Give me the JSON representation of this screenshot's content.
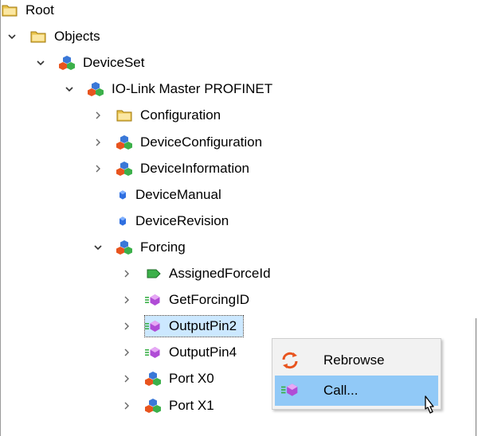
{
  "tree": {
    "items": [
      {
        "label": "Root",
        "icon": "folder-icon",
        "expanded": true
      },
      {
        "label": "Objects",
        "icon": "folder-icon",
        "expanded": true
      },
      {
        "label": "DeviceSet",
        "icon": "object-icon",
        "expanded": true
      },
      {
        "label": "IO-Link Master PROFINET",
        "icon": "object-icon",
        "expanded": true
      },
      {
        "label": "Configuration",
        "icon": "folder-icon",
        "expanded": false
      },
      {
        "label": "DeviceConfiguration",
        "icon": "object-icon",
        "expanded": false
      },
      {
        "label": "DeviceInformation",
        "icon": "object-icon",
        "expanded": false
      },
      {
        "label": "DeviceManual",
        "icon": "property-icon"
      },
      {
        "label": "DeviceRevision",
        "icon": "property-icon"
      },
      {
        "label": "Forcing",
        "icon": "object-icon",
        "expanded": true
      },
      {
        "label": "AssignedForceId",
        "icon": "variable-icon",
        "expanded": false
      },
      {
        "label": "GetForcingID",
        "icon": "method-icon",
        "expanded": false
      },
      {
        "label": "OutputPin2",
        "icon": "method-icon",
        "expanded": false,
        "selected": true
      },
      {
        "label": "OutputPin4",
        "icon": "method-icon",
        "expanded": false
      },
      {
        "label": "Port X0",
        "icon": "object-icon",
        "expanded": false
      },
      {
        "label": "Port X1",
        "icon": "object-icon",
        "expanded": false
      }
    ]
  },
  "context_menu": {
    "items": [
      {
        "label": "Rebrowse",
        "icon": "refresh-icon"
      },
      {
        "label": "Call...",
        "icon": "method-icon",
        "hovered": true
      }
    ]
  },
  "colors": {
    "selection": "#cce8ff",
    "menu_hover": "#91c9f7",
    "folder": "#e8c24a",
    "refresh": "#e8541e"
  }
}
